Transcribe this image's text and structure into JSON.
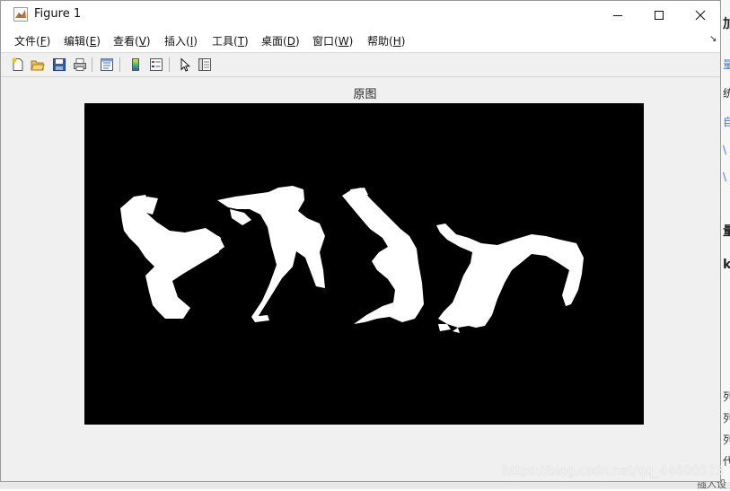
{
  "window": {
    "title": "Figure 1"
  },
  "menu": [
    {
      "text": "文件(",
      "acc": "F",
      "end": ")"
    },
    {
      "text": "编辑(",
      "acc": "E",
      "end": ")"
    },
    {
      "text": "查看(",
      "acc": "V",
      "end": ")"
    },
    {
      "text": "插入(",
      "acc": "I",
      "end": ")"
    },
    {
      "text": "工具(",
      "acc": "T",
      "end": ")"
    },
    {
      "text": "桌面(",
      "acc": "D",
      "end": ")"
    },
    {
      "text": "窗口(",
      "acc": "W",
      "end": ")"
    },
    {
      "text": "帮助(",
      "acc": "H",
      "end": ")"
    }
  ],
  "toolbar_icons": [
    "new-figure-icon",
    "open-file-icon",
    "save-icon",
    "print-icon",
    "link-plot-icon",
    "colorbar-icon",
    "legend-icon",
    "pointer-icon",
    "property-editor-icon"
  ],
  "axes": {
    "title": "原图",
    "image": "binary silhouettes of four dancers on black background"
  },
  "watermark": "https://blog.csdn.net/qq_44600573",
  "background_fragments": [
    "加",
    "量",
    "统",
    "自",
    "\\",
    "\\",
    "量",
    "k",
    "列",
    "列",
    "列",
    "代",
    "插入设"
  ],
  "colors": {
    "axes_bg": "#000000",
    "window_bg": "#f0f0f0",
    "silhouette": "#ffffff"
  }
}
